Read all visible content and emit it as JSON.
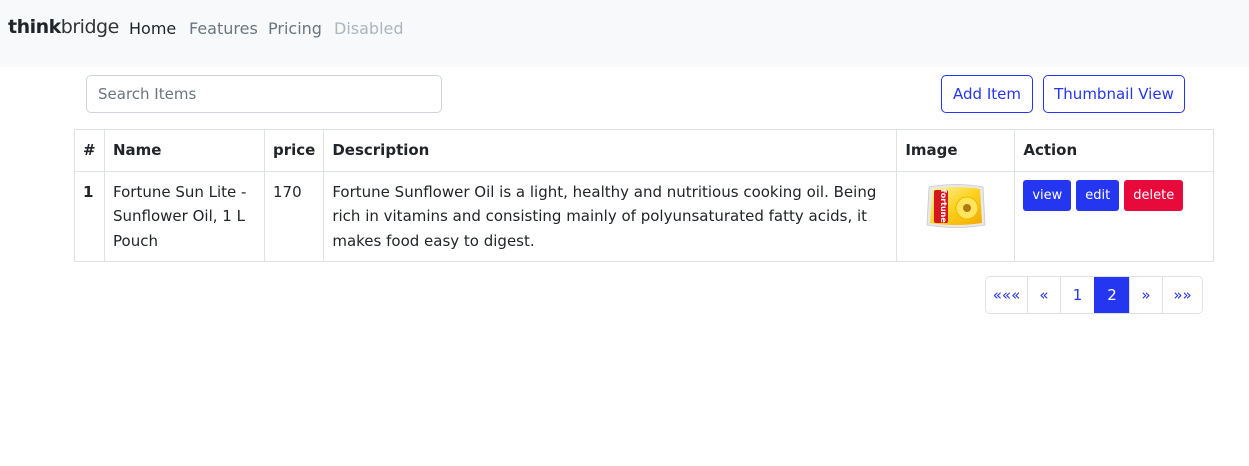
{
  "brand": {
    "part1": "think",
    "part2": "bridge"
  },
  "nav": [
    {
      "label": "Home",
      "state": "active"
    },
    {
      "label": "Features",
      "state": "normal"
    },
    {
      "label": "Pricing",
      "state": "normal"
    },
    {
      "label": "Disabled",
      "state": "disabled"
    }
  ],
  "search": {
    "placeholder": "Search Items",
    "value": ""
  },
  "toolbar": {
    "add_label": "Add Item",
    "thumbnail_label": "Thumbnail View"
  },
  "table": {
    "headers": [
      "#",
      "Name",
      "price",
      "Description",
      "Image",
      "Action"
    ],
    "rows": [
      {
        "index": "1",
        "name": "Fortune Sun Lite - Sunflower Oil, 1 L Pouch",
        "price": "170",
        "description": "Fortune Sunflower Oil is a light, healthy and nutritious cooking oil. Being rich in vitamins and consisting mainly of polyunsaturated fatty acids, it makes food easy to digest.",
        "image_text": "fortune",
        "actions": {
          "view": "view",
          "edit": "edit",
          "delete": "delete"
        }
      }
    ]
  },
  "pagination": {
    "items": [
      "«««",
      "«",
      "1",
      "2",
      "»",
      "»»"
    ],
    "active": "2"
  },
  "colors": {
    "primary": "#2536f0",
    "danger": "#e90a3c",
    "navbar_bg": "#f8f9fa"
  }
}
